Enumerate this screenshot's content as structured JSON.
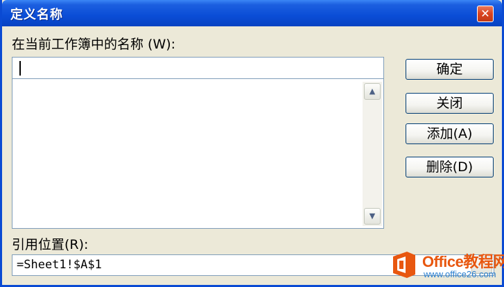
{
  "dialog": {
    "title": "定义名称",
    "close_glyph": "✕"
  },
  "names_section": {
    "label": "在当前工作簿中的名称 (W):",
    "input_value": "",
    "list_items": []
  },
  "buttons": {
    "ok": "确定",
    "close": "关闭",
    "add": "添加(A)",
    "delete": "删除(D)"
  },
  "reference": {
    "label": "引用位置(R):",
    "value": "=Sheet1!$A$1"
  },
  "scrollbar": {
    "up_glyph": "▲",
    "down_glyph": "▼"
  },
  "watermark": {
    "brand": "Office教程网",
    "url": "www.office26.com"
  },
  "colors": {
    "titlebar": "#0a4dd6",
    "face": "#ece9d8",
    "watermark_orange": "#e8570f",
    "watermark_blue": "#2a7fd0"
  }
}
